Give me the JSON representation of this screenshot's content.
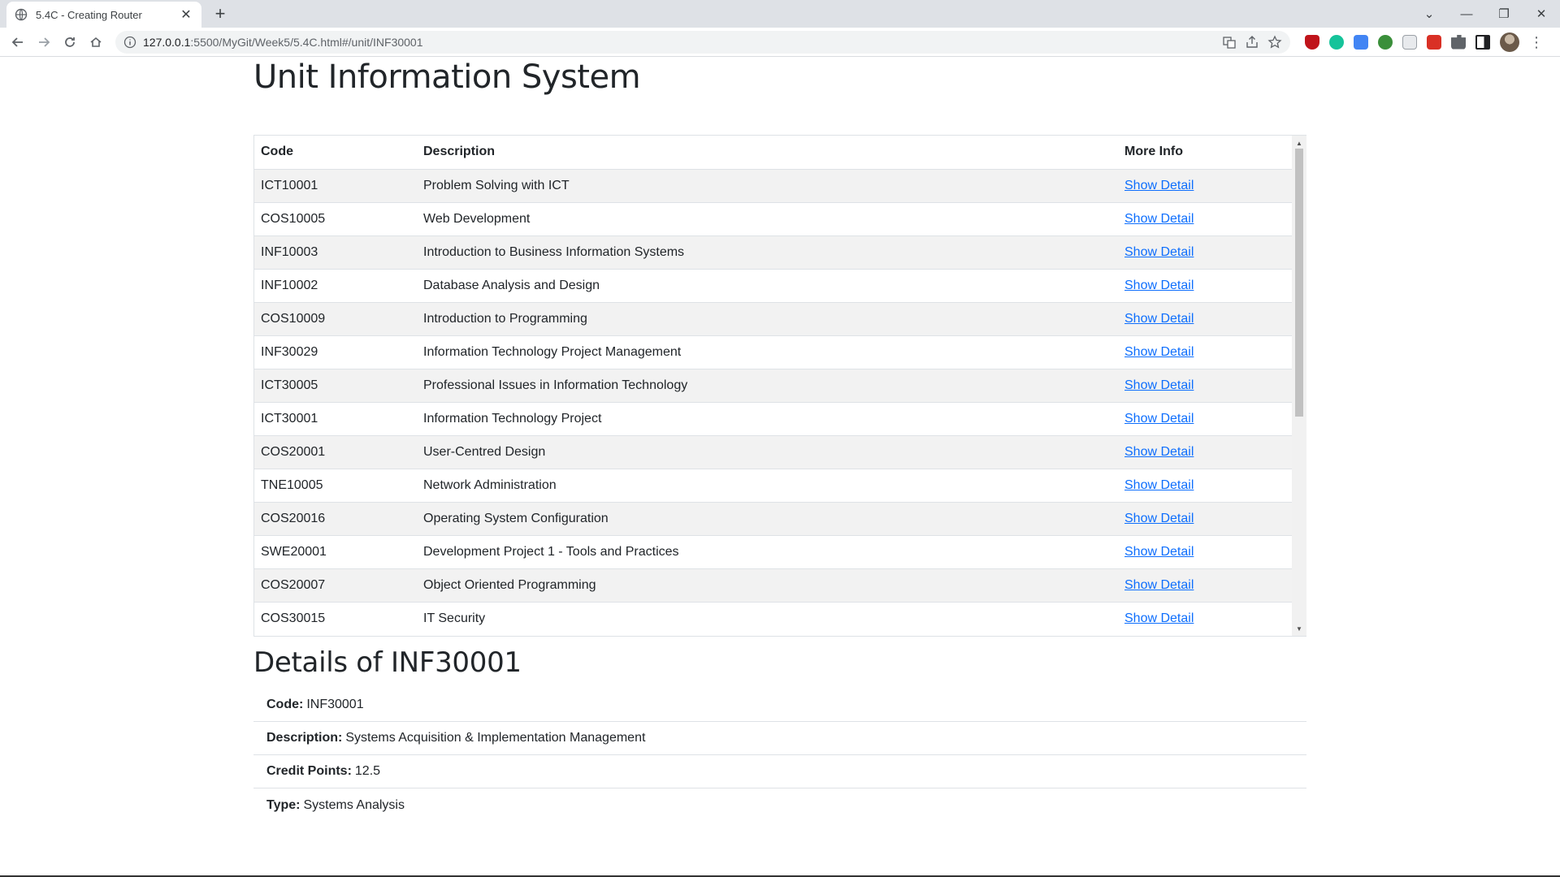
{
  "browser": {
    "tab_title": "5.4C - Creating Router",
    "url_host": "127.0.0.1",
    "url_path": ":5500/MyGit/Week5/5.4C.html#/unit/INF30001"
  },
  "app": {
    "title": "Unit Information System"
  },
  "table": {
    "headers": {
      "code": "Code",
      "description": "Description",
      "more": "More Info"
    },
    "link_label": "Show Detail",
    "rows": [
      {
        "code": "ICT10001",
        "description": "Problem Solving with ICT"
      },
      {
        "code": "COS10005",
        "description": "Web Development"
      },
      {
        "code": "INF10003",
        "description": "Introduction to Business Information Systems"
      },
      {
        "code": "INF10002",
        "description": "Database Analysis and Design"
      },
      {
        "code": "COS10009",
        "description": "Introduction to Programming"
      },
      {
        "code": "INF30029",
        "description": "Information Technology Project Management"
      },
      {
        "code": "ICT30005",
        "description": "Professional Issues in Information Technology"
      },
      {
        "code": "ICT30001",
        "description": "Information Technology Project"
      },
      {
        "code": "COS20001",
        "description": "User-Centred Design"
      },
      {
        "code": "TNE10005",
        "description": "Network Administration"
      },
      {
        "code": "COS20016",
        "description": "Operating System Configuration"
      },
      {
        "code": "SWE20001",
        "description": "Development Project 1 - Tools and Practices"
      },
      {
        "code": "COS20007",
        "description": "Object Oriented Programming"
      },
      {
        "code": "COS30015",
        "description": "IT Security"
      }
    ]
  },
  "details": {
    "title": "Details of INF30001",
    "code_label": "Code:",
    "code": "INF30001",
    "description_label": "Description:",
    "description": "Systems Acquisition & Implementation Management",
    "credit_label": "Credit Points:",
    "credit": "12.5",
    "type_label": "Type:",
    "type": "Systems Analysis"
  },
  "colors": {
    "link": "#0d6efd",
    "stripe": "#f2f2f2",
    "border": "#dee2e6"
  }
}
